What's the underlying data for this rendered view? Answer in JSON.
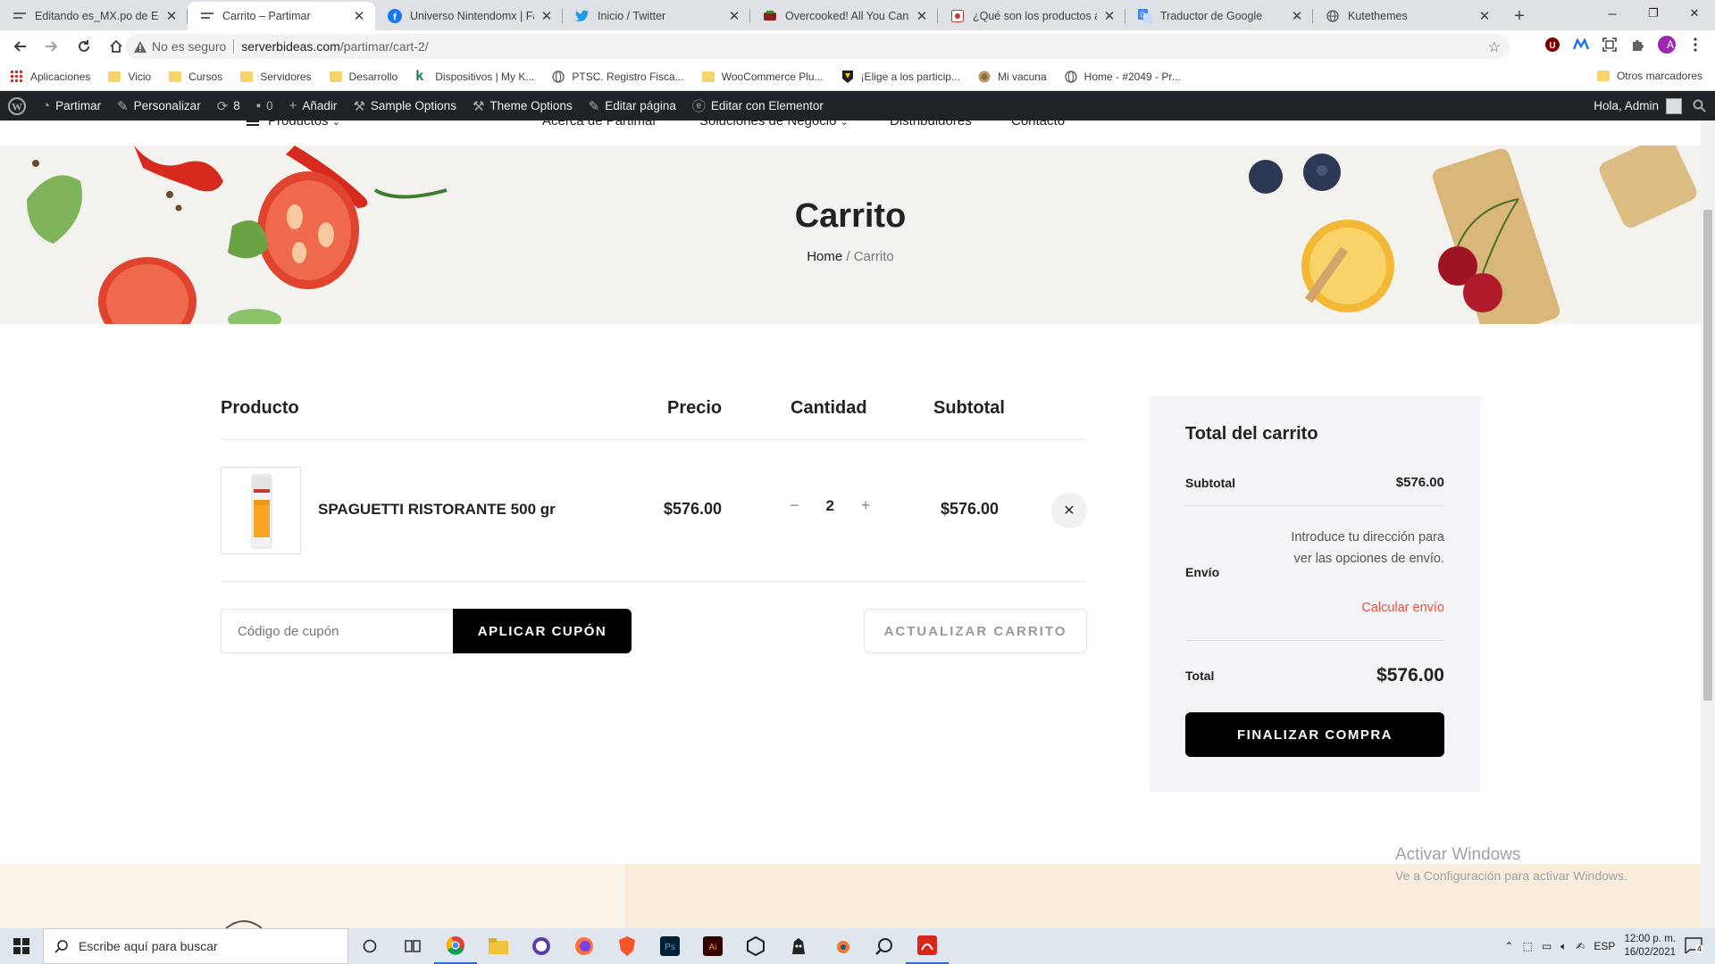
{
  "browser": {
    "tabs": [
      {
        "title": "Editando es_MX.po de Ecot",
        "icon": "editor-favicon",
        "active": false
      },
      {
        "title": "Carrito – Partimar",
        "icon": "site-favicon",
        "active": true
      },
      {
        "title": "Universo Nintendomx | Face",
        "icon": "facebook-favicon",
        "active": false
      },
      {
        "title": "Inicio / Twitter",
        "icon": "twitter-favicon",
        "active": false
      },
      {
        "title": "Overcooked! All You Can Ea",
        "icon": "game-favicon",
        "active": false
      },
      {
        "title": "¿Qué son los productos agr",
        "icon": "article-favicon",
        "active": false
      },
      {
        "title": "Traductor de Google",
        "icon": "translate-favicon",
        "active": false
      },
      {
        "title": "Kutethemes",
        "icon": "globe-favicon",
        "active": false
      }
    ],
    "security_label": "No es seguro",
    "url_host": "serverbideas.com",
    "url_path": "/partimar/cart-2/",
    "profile_initial": "A"
  },
  "bookmarks": {
    "items": [
      {
        "label": "Aplicaciones",
        "type": "apps"
      },
      {
        "label": "Vicio",
        "type": "folder"
      },
      {
        "label": "Cursos",
        "type": "folder"
      },
      {
        "label": "Servidores",
        "type": "folder"
      },
      {
        "label": "Desarrollo",
        "type": "folder"
      },
      {
        "label": "Dispositivos | My K...",
        "type": "k"
      },
      {
        "label": "PTSC. Registro Fisca...",
        "type": "globe"
      },
      {
        "label": "WooCommerce Plu...",
        "type": "folder"
      },
      {
        "label": "¡Elige a los particip...",
        "type": "badge"
      },
      {
        "label": "Mi vacuna",
        "type": "seal"
      },
      {
        "label": "Home - #2049 - Pr...",
        "type": "globe"
      }
    ],
    "other": "Otros marcadores"
  },
  "wp_admin": {
    "site": "Partimar",
    "customize": "Personalizar",
    "updates": "8",
    "comments": "0",
    "new": "Añadir",
    "sample_options": "Sample Options",
    "theme_options": "Theme Options",
    "edit_page": "Editar página",
    "elementor": "Editar con Elementor",
    "greeting": "Hola, Admin"
  },
  "site_nav": {
    "products": "Productos",
    "about": "Acerca de Partimar",
    "solutions": "Soluciones de Negocio",
    "distributors": "Distribuidores",
    "contact": "Contacto"
  },
  "hero": {
    "title": "Carrito",
    "breadcrumb_home": "Home",
    "breadcrumb_sep": "/",
    "breadcrumb_current": "Carrito"
  },
  "cart": {
    "headers": {
      "product": "Producto",
      "price": "Precio",
      "quantity": "Cantidad",
      "subtotal": "Subtotal"
    },
    "items": [
      {
        "name": "SPAGUETTI RISTORANTE 500 gr",
        "price": "$576.00",
        "quantity": "2",
        "subtotal": "$576.00"
      }
    ],
    "coupon_placeholder": "Código de cupón",
    "apply_coupon": "APLICAR CUPÓN",
    "update_cart": "ACTUALIZAR CARRITO"
  },
  "totals": {
    "title": "Total del carrito",
    "subtotal_label": "Subtotal",
    "subtotal_value": "$576.00",
    "shipping_label": "Envío",
    "shipping_note": "Introduce tu dirección para ver las opciones de envío.",
    "calculate_shipping": "Calcular envío",
    "total_label": "Total",
    "total_value": "$576.00",
    "checkout": "FINALIZAR COMPRA"
  },
  "watermark": {
    "line1": "Activar Windows",
    "line2": "Ve a Configuración para activar Windows."
  },
  "taskbar": {
    "search_placeholder": "Escribe aquí para buscar",
    "language": "ESP",
    "time": "12:00 p. m.",
    "date": "16/02/2021",
    "notifications": "4"
  },
  "colors": {
    "accent_link": "#e8503a",
    "button_dark": "#000000",
    "wp_bar": "#1d2327",
    "totals_bg": "#f4f4f8"
  }
}
